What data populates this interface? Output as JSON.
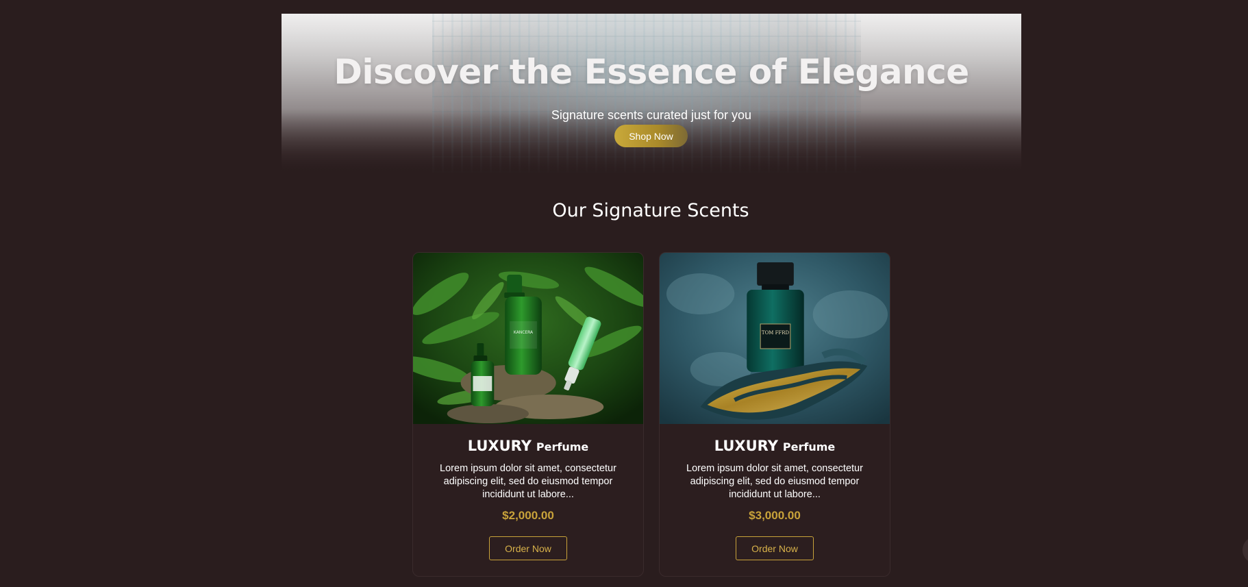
{
  "colors": {
    "page_background": "#2a1d1e",
    "accent_gold": "#c9a33a",
    "card_background": "#2c1e1f",
    "text": "#ffffff"
  },
  "hero": {
    "title": "Discover the Essence of Elegance",
    "subtitle": "Signature scents curated just for you",
    "cta_label": "Shop Now"
  },
  "section": {
    "title": "Our Signature Scents"
  },
  "products": [
    {
      "title_brand": "LUXURY",
      "title_type": "Perfume",
      "description": "Lorem ipsum dolor sit amet, consectetur adipiscing elit, sed do eiusmod tempor incididunt ut labore...",
      "price": "$2,000.00",
      "order_label": "Order Now",
      "bottle_label": "KANCERA"
    },
    {
      "title_brand": "LUXURY",
      "title_type": "Perfume",
      "description": "Lorem ipsum dolor sit amet, consectetur adipiscing elit, sed do eiusmod tempor incididunt ut labore...",
      "price": "$3,000.00",
      "order_label": "Order Now",
      "bottle_label": "TOM FFRD"
    }
  ]
}
